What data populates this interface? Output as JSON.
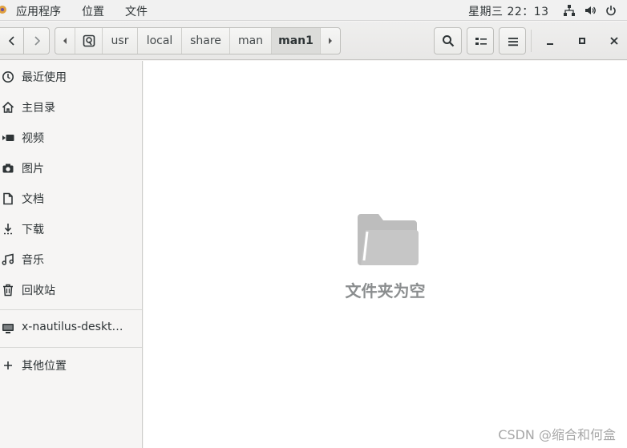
{
  "topbar": {
    "menus": [
      "应用程序",
      "位置",
      "文件"
    ],
    "clock": "星期三 22：13"
  },
  "header": {
    "path": [
      "usr",
      "local",
      "share",
      "man",
      "man1"
    ]
  },
  "sidebar": {
    "items": [
      {
        "label": "最近使用",
        "icon": "clock-icon"
      },
      {
        "label": "主目录",
        "icon": "home-icon"
      },
      {
        "label": "视频",
        "icon": "video-icon"
      },
      {
        "label": "图片",
        "icon": "camera-icon"
      },
      {
        "label": "文档",
        "icon": "document-icon"
      },
      {
        "label": "下载",
        "icon": "download-icon"
      },
      {
        "label": "音乐",
        "icon": "music-icon"
      },
      {
        "label": "回收站",
        "icon": "trash-icon"
      }
    ],
    "device": {
      "label": "x-nautilus-deskt…",
      "icon": "desktop-icon"
    },
    "other": {
      "label": "其他位置",
      "icon": "plus-icon"
    }
  },
  "main": {
    "empty_text": "文件夹为空",
    "watermark": "CSDN @缩合和何盒"
  }
}
